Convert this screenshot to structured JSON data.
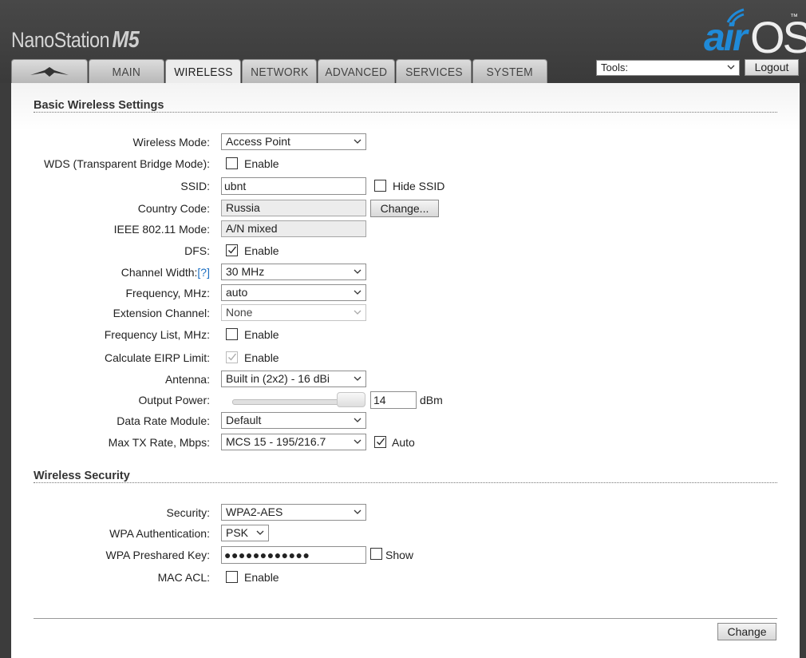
{
  "header": {
    "brand_name": "NanoStation",
    "brand_model": "M5",
    "logo_air": "air",
    "logo_os": "OS",
    "logo_tm": "™"
  },
  "tabs": [
    {
      "label": "",
      "icon": "ubiquiti-logo-icon"
    },
    {
      "label": "MAIN"
    },
    {
      "label": "WIRELESS",
      "active": true
    },
    {
      "label": "NETWORK"
    },
    {
      "label": "ADVANCED"
    },
    {
      "label": "SERVICES"
    },
    {
      "label": "SYSTEM"
    }
  ],
  "tools": {
    "selected": "Tools:"
  },
  "logout_label": "Logout",
  "basic": {
    "title": "Basic Wireless Settings",
    "wireless_mode": {
      "label": "Wireless Mode:",
      "value": "Access Point"
    },
    "wds": {
      "label": "WDS (Transparent Bridge Mode):",
      "checkbox_label": "Enable",
      "checked": false
    },
    "ssid": {
      "label": "SSID:",
      "value": "ubnt",
      "hide_label": "Hide SSID",
      "hide_checked": false
    },
    "country": {
      "label": "Country Code:",
      "value": "Russia",
      "change_label": "Change..."
    },
    "ieee": {
      "label": "IEEE 802.11 Mode:",
      "value": "A/N mixed"
    },
    "dfs": {
      "label": "DFS:",
      "checkbox_label": "Enable",
      "checked": true
    },
    "channel_width": {
      "label": "Channel Width:",
      "help": "[?]",
      "value": "30 MHz"
    },
    "frequency": {
      "label": "Frequency, MHz:",
      "value": "auto"
    },
    "extension_channel": {
      "label": "Extension Channel:",
      "value": "None"
    },
    "frequency_list": {
      "label": "Frequency List, MHz:",
      "checkbox_label": "Enable",
      "checked": false
    },
    "eirp": {
      "label": "Calculate EIRP Limit:",
      "checkbox_label": "Enable",
      "checked": true,
      "disabled": true
    },
    "antenna": {
      "label": "Antenna:",
      "value": "Built in (2x2) - 16 dBi"
    },
    "output_power": {
      "label": "Output Power:",
      "value": "14",
      "unit": "dBm",
      "slider_fraction": 0.9
    },
    "data_rate_module": {
      "label": "Data Rate Module:",
      "value": "Default"
    },
    "max_tx_rate": {
      "label": "Max TX Rate, Mbps:",
      "value": "MCS 15 - 195/216.7",
      "auto_label": "Auto",
      "auto_checked": true
    }
  },
  "security": {
    "title": "Wireless Security",
    "security": {
      "label": "Security:",
      "value": "WPA2-AES"
    },
    "wpa_auth": {
      "label": "WPA Authentication:",
      "value": "PSK"
    },
    "psk": {
      "label": "WPA Preshared Key:",
      "value": "●●●●●●●●●●●●",
      "show_label": "Show",
      "show_checked": false
    },
    "mac_acl": {
      "label": "MAC ACL:",
      "checkbox_label": "Enable",
      "checked": false
    }
  },
  "change_label": "Change"
}
